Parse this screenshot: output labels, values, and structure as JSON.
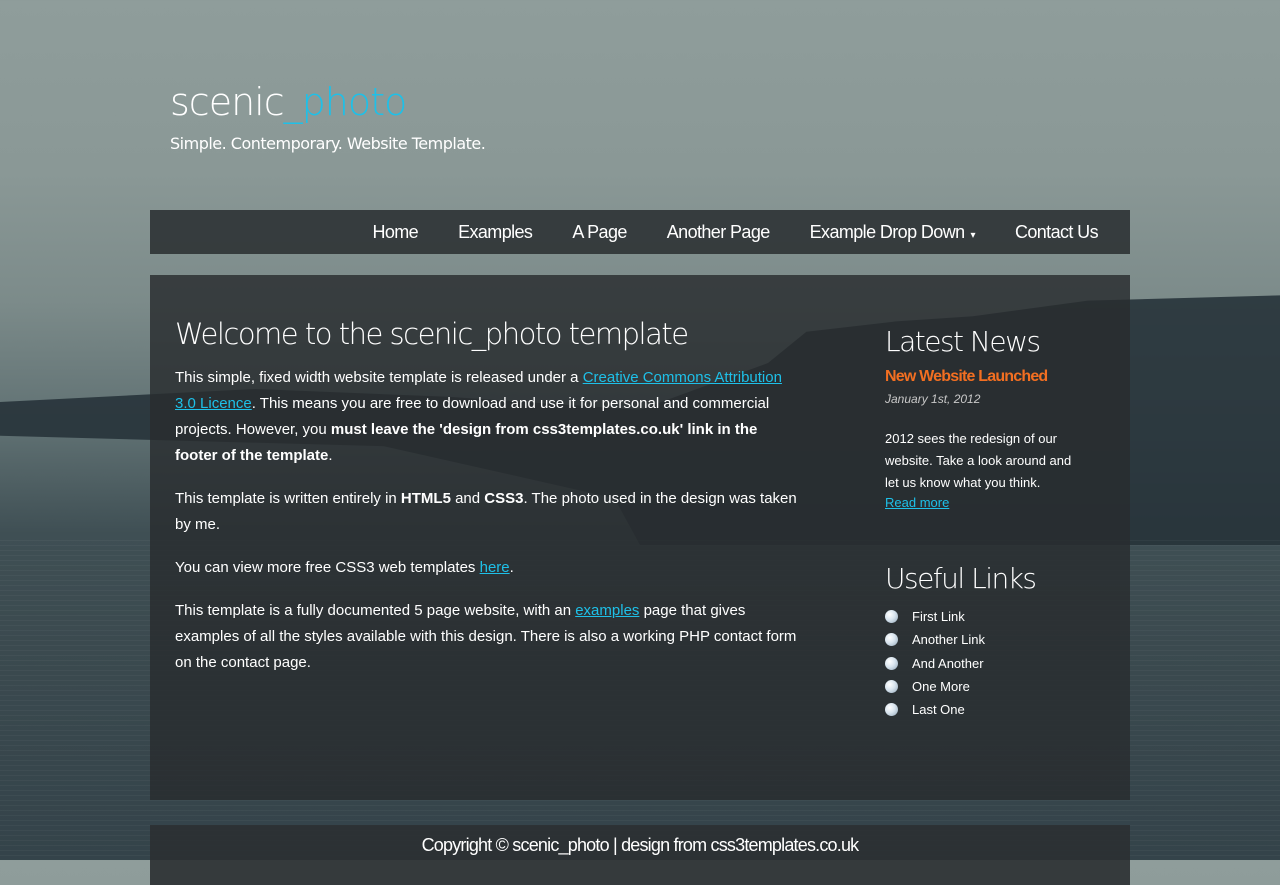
{
  "header": {
    "logo_main": "scenic",
    "logo_accent": "_photo",
    "slogan": "Simple. Contemporary. Website Template."
  },
  "menu": {
    "items": [
      {
        "label": "Home"
      },
      {
        "label": "Examples"
      },
      {
        "label": "A Page"
      },
      {
        "label": "Another Page"
      },
      {
        "label": "Example Drop Down"
      },
      {
        "label": "Contact Us"
      }
    ]
  },
  "content": {
    "title": "Welcome to the scenic_photo template",
    "p1": {
      "t1": "This simple, fixed width website template is released under a ",
      "link": "Creative Commons Attribution 3.0 Licence",
      "t2": ". This means you are free to download and use it for personal and commercial projects. However, you ",
      "bold": "must leave the 'design from css3templates.co.uk' link in the footer of the template",
      "t3": "."
    },
    "p2": {
      "t1": "This template is written entirely in ",
      "b1": "HTML5",
      "t2": " and ",
      "b2": "CSS3",
      "t3": ". The photo used in the design was taken by me."
    },
    "p3": {
      "t1": "You can view more free CSS3 web templates ",
      "link": "here",
      "t2": "."
    },
    "p4": {
      "t1": "This template is a fully documented 5 page website, with an ",
      "link": "examples",
      "t2": " page that gives examples of all the styles available with this design. There is also a working PHP contact form on the contact page."
    }
  },
  "sidebar": {
    "news_heading": "Latest News",
    "news_title": "New Website Launched",
    "news_date": "January 1st, 2012",
    "news_body": "2012 sees the redesign of our website. Take a look around and let us know what you think.",
    "news_more": "Read more",
    "links_heading": "Useful Links",
    "links": [
      "First Link",
      "Another Link",
      "And Another",
      "One More",
      "Last One"
    ]
  },
  "footer": {
    "text": "Copyright © scenic_photo | design from css3templates.co.uk"
  },
  "colors": {
    "accent": "#1ec0e8",
    "news_title": "#f36f21"
  }
}
